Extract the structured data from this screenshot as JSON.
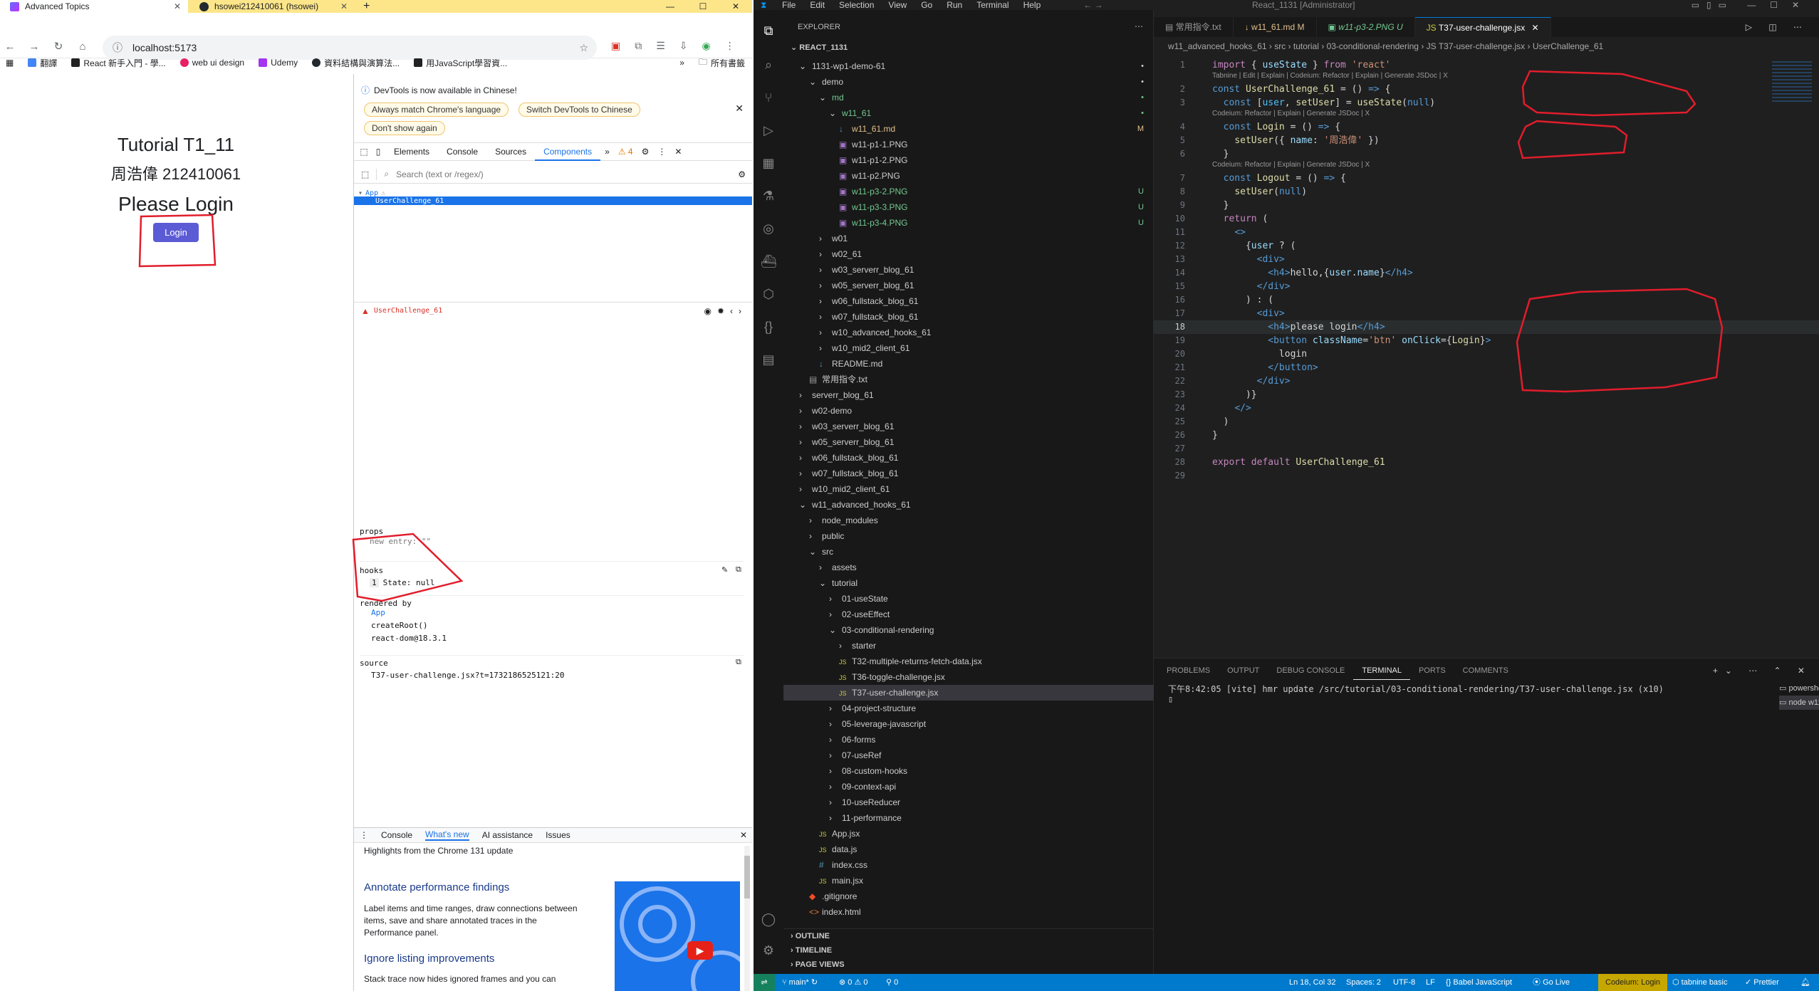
{
  "browser": {
    "tabs": [
      {
        "title": "Advanced Topics",
        "active": true
      },
      {
        "title": "hsowei212410061 (hsowei)",
        "active": false
      }
    ],
    "new_tab": "+",
    "url": "localhost:5173",
    "bookmarks": [
      "翻譯",
      "React 新手入門 - 學...",
      "web ui design",
      "Udemy",
      "資料結構與演算法...",
      "用JavaScript學習資..."
    ],
    "bookmarks_more": "»",
    "bookmarks_folder": "所有書籤"
  },
  "app": {
    "heading": "Tutorial T1_11",
    "subheading": "周浩偉 212410061",
    "please_login": "Please Login",
    "login_button": "Login"
  },
  "devtools": {
    "banner": "DevTools is now available in Chinese!",
    "pill_match": "Always match Chrome's language",
    "pill_switch": "Switch DevTools to Chinese",
    "pill_dont": "Don't show again",
    "tabs": [
      "Elements",
      "Console",
      "Sources",
      "Components"
    ],
    "more": "»",
    "warnings": "4",
    "search_placeholder": "Search (text or /regex/)",
    "tree_root": "App",
    "tree_child": "UserChallenge_61",
    "selected_name": "UserChallenge_61",
    "props_label": "props",
    "props_entry": "new entry: \"\"",
    "hooks_label": "hooks",
    "hook_index": "1",
    "hook_state": "State: null",
    "rendered_by_label": "rendered by",
    "rendered_by": [
      "App",
      "createRoot()",
      "react-dom@18.3.1"
    ],
    "source_label": "source",
    "source_file": "T37-user-challenge.jsx?t=1732186525121:20",
    "drawer_tabs": [
      "Console",
      "What's new",
      "AI assistance",
      "Issues"
    ],
    "highlights": "Highlights from the Chrome 131 update",
    "feature1_title": "Annotate performance findings",
    "feature1_body": "Label items and time ranges, draw connections between items, save and share annotated traces in the Performance panel.",
    "feature2_title": "Ignore listing improvements",
    "feature2_body": "Stack trace now hides ignored frames and you can"
  },
  "vscode": {
    "menu": [
      "File",
      "Edit",
      "Selection",
      "View",
      "Go",
      "Run",
      "Terminal",
      "Help"
    ],
    "search_box": "React_1131 [Administrator]",
    "explorer_title": "EXPLORER",
    "workspace": "REACT_1131",
    "tree": [
      {
        "label": "1131-wp1-demo-61",
        "depth": 1,
        "kind": "folder-open",
        "badge": "•"
      },
      {
        "label": "demo",
        "depth": 2,
        "kind": "folder-open",
        "badge": "•"
      },
      {
        "label": "md",
        "depth": 3,
        "kind": "folder-open",
        "badge": "•",
        "color": "#73c991"
      },
      {
        "label": "w11_61",
        "depth": 4,
        "kind": "folder-open",
        "badge": "•",
        "color": "#73c991"
      },
      {
        "label": "w11_61.md",
        "depth": 5,
        "kind": "md",
        "badge": "M",
        "color": "#e2c08d"
      },
      {
        "label": "w11-p1-1.PNG",
        "depth": 5,
        "kind": "img"
      },
      {
        "label": "w11-p1-2.PNG",
        "depth": 5,
        "kind": "img"
      },
      {
        "label": "w11-p2.PNG",
        "depth": 5,
        "kind": "img"
      },
      {
        "label": "w11-p3-2.PNG",
        "depth": 5,
        "kind": "img",
        "badge": "U",
        "color": "#73c991"
      },
      {
        "label": "w11-p3-3.PNG",
        "depth": 5,
        "kind": "img",
        "badge": "U",
        "color": "#73c991"
      },
      {
        "label": "w11-p3-4.PNG",
        "depth": 5,
        "kind": "img",
        "badge": "U",
        "color": "#73c991"
      },
      {
        "label": "w01",
        "depth": 3,
        "kind": "folder"
      },
      {
        "label": "w02_61",
        "depth": 3,
        "kind": "folder"
      },
      {
        "label": "w03_serverr_blog_61",
        "depth": 3,
        "kind": "folder"
      },
      {
        "label": "w05_serverr_blog_61",
        "depth": 3,
        "kind": "folder"
      },
      {
        "label": "w06_fullstack_blog_61",
        "depth": 3,
        "kind": "folder"
      },
      {
        "label": "w07_fullstack_blog_61",
        "depth": 3,
        "kind": "folder"
      },
      {
        "label": "w10_advanced_hooks_61",
        "depth": 3,
        "kind": "folder"
      },
      {
        "label": "w10_mid2_client_61",
        "depth": 3,
        "kind": "folder"
      },
      {
        "label": "README.md",
        "depth": 3,
        "kind": "md"
      },
      {
        "label": "常用指令.txt",
        "depth": 2,
        "kind": "txt"
      },
      {
        "label": "serverr_blog_61",
        "depth": 1,
        "kind": "folder"
      },
      {
        "label": "w02-demo",
        "depth": 1,
        "kind": "folder"
      },
      {
        "label": "w03_serverr_blog_61",
        "depth": 1,
        "kind": "folder"
      },
      {
        "label": "w05_serverr_blog_61",
        "depth": 1,
        "kind": "folder"
      },
      {
        "label": "w06_fullstack_blog_61",
        "depth": 1,
        "kind": "folder"
      },
      {
        "label": "w07_fullstack_blog_61",
        "depth": 1,
        "kind": "folder"
      },
      {
        "label": "w10_mid2_client_61",
        "depth": 1,
        "kind": "folder"
      },
      {
        "label": "w11_advanced_hooks_61",
        "depth": 1,
        "kind": "folder-open"
      },
      {
        "label": "node_modules",
        "depth": 2,
        "kind": "folder"
      },
      {
        "label": "public",
        "depth": 2,
        "kind": "folder"
      },
      {
        "label": "src",
        "depth": 2,
        "kind": "folder-open"
      },
      {
        "label": "assets",
        "depth": 3,
        "kind": "folder"
      },
      {
        "label": "tutorial",
        "depth": 3,
        "kind": "folder-open"
      },
      {
        "label": "01-useState",
        "depth": 4,
        "kind": "folder"
      },
      {
        "label": "02-useEffect",
        "depth": 4,
        "kind": "folder"
      },
      {
        "label": "03-conditional-rendering",
        "depth": 4,
        "kind": "folder-open"
      },
      {
        "label": "starter",
        "depth": 5,
        "kind": "folder"
      },
      {
        "label": "T32-multiple-returns-fetch-data.jsx",
        "depth": 5,
        "kind": "js"
      },
      {
        "label": "T36-toggle-challenge.jsx",
        "depth": 5,
        "kind": "js"
      },
      {
        "label": "T37-user-challenge.jsx",
        "depth": 5,
        "kind": "js",
        "selected": true
      },
      {
        "label": "04-project-structure",
        "depth": 4,
        "kind": "folder"
      },
      {
        "label": "05-leverage-javascript",
        "depth": 4,
        "kind": "folder"
      },
      {
        "label": "06-forms",
        "depth": 4,
        "kind": "folder"
      },
      {
        "label": "07-useRef",
        "depth": 4,
        "kind": "folder"
      },
      {
        "label": "08-custom-hooks",
        "depth": 4,
        "kind": "folder"
      },
      {
        "label": "09-context-api",
        "depth": 4,
        "kind": "folder"
      },
      {
        "label": "10-useReducer",
        "depth": 4,
        "kind": "folder"
      },
      {
        "label": "11-performance",
        "depth": 4,
        "kind": "folder"
      },
      {
        "label": "App.jsx",
        "depth": 3,
        "kind": "js"
      },
      {
        "label": "data.js",
        "depth": 3,
        "kind": "js"
      },
      {
        "label": "index.css",
        "depth": 3,
        "kind": "css"
      },
      {
        "label": "main.jsx",
        "depth": 3,
        "kind": "js"
      },
      {
        "label": ".gitignore",
        "depth": 2,
        "kind": "git"
      },
      {
        "label": "index.html",
        "depth": 2,
        "kind": "html"
      }
    ],
    "outline": "OUTLINE",
    "timeline": "TIMELINE",
    "page_views": "PAGE VIEWS",
    "editor_tabs": [
      "常用指令.txt",
      "w11_61.md M",
      "w11-p3-2.PNG U",
      "T37-user-challenge.jsx"
    ],
    "breadcrumb": "w11_advanced_hooks_61 › src › tutorial › 03-conditional-rendering › JS T37-user-challenge.jsx › UserChallenge_61",
    "lens_tabnine": "Tabnine | Edit | Explain | Codeium: Refactor | Explain | Generate JSDoc | X",
    "lens_codeium": "Codeium: Refactor | Explain | Generate JSDoc | X",
    "panel_tabs": [
      "PROBLEMS",
      "OUTPUT",
      "DEBUG CONSOLE",
      "TERMINAL",
      "PORTS",
      "COMMENTS"
    ],
    "terminal_line": "下午8:42:05 [vite] hmr update /src/tutorial/03-conditional-rendering/T37-user-challenge.jsx (x10)",
    "terminals": [
      "powershell",
      "node w11_a..."
    ],
    "status": {
      "branch": "main*",
      "errors": "⊗ 0 ⚠ 0",
      "ports": "⚲ 0",
      "position": "Ln 18, Col 32",
      "spaces": "Spaces: 2",
      "encoding": "UTF-8",
      "eol": "LF",
      "language": "Babel JavaScript",
      "golive": "Go Live",
      "codeium": "Codeium: Login",
      "tabnine": "tabnine basic",
      "prettier": "Prettier"
    }
  },
  "code_lines": [
    {
      "n": "1",
      "segs": [
        [
          "kw2",
          "import"
        ],
        [
          "pun",
          " { "
        ],
        [
          "var",
          "useState"
        ],
        [
          "pun",
          " } "
        ],
        [
          "kw2",
          "from"
        ],
        [
          "str",
          " 'react'"
        ]
      ]
    },
    {
      "n": "2",
      "segs": [
        [
          "kw",
          "const"
        ],
        [
          "pun",
          " "
        ],
        [
          "fn",
          "UserChallenge_61"
        ],
        [
          "pun",
          " = () "
        ],
        [
          "kw",
          "=>"
        ],
        [
          "pun",
          " {"
        ]
      ]
    },
    {
      "n": "3",
      "segs": [
        [
          "pun",
          "  "
        ],
        [
          "kw",
          "const"
        ],
        [
          "pun",
          " ["
        ],
        [
          "cst",
          "user"
        ],
        [
          "pun",
          ", "
        ],
        [
          "fn",
          "setUser"
        ],
        [
          "pun",
          "] = "
        ],
        [
          "fn",
          "useState"
        ],
        [
          "pun",
          "("
        ],
        [
          "kw",
          "null"
        ],
        [
          "pun",
          ")"
        ]
      ]
    },
    {
      "n": "4",
      "segs": [
        [
          "pun",
          "  "
        ],
        [
          "kw",
          "const"
        ],
        [
          "pun",
          " "
        ],
        [
          "fn",
          "Login"
        ],
        [
          "pun",
          " = () "
        ],
        [
          "kw",
          "=>"
        ],
        [
          "pun",
          " {"
        ]
      ]
    },
    {
      "n": "5",
      "segs": [
        [
          "pun",
          "    "
        ],
        [
          "fn",
          "setUser"
        ],
        [
          "pun",
          "({ "
        ],
        [
          "var",
          "name"
        ],
        [
          "pun",
          ": "
        ],
        [
          "str",
          "'周浩偉'"
        ],
        [
          "pun",
          " })"
        ]
      ]
    },
    {
      "n": "6",
      "segs": [
        [
          "pun",
          "  }"
        ]
      ]
    },
    {
      "n": "7",
      "segs": [
        [
          "pun",
          "  "
        ],
        [
          "kw",
          "const"
        ],
        [
          "pun",
          " "
        ],
        [
          "fn",
          "Logout"
        ],
        [
          "pun",
          " = () "
        ],
        [
          "kw",
          "=>"
        ],
        [
          "pun",
          " {"
        ]
      ]
    },
    {
      "n": "8",
      "segs": [
        [
          "pun",
          "    "
        ],
        [
          "fn",
          "setUser"
        ],
        [
          "pun",
          "("
        ],
        [
          "kw",
          "null"
        ],
        [
          "pun",
          ")"
        ]
      ]
    },
    {
      "n": "9",
      "segs": [
        [
          "pun",
          "  }"
        ]
      ]
    },
    {
      "n": "10",
      "segs": [
        [
          "pun",
          "  "
        ],
        [
          "kw2",
          "return"
        ],
        [
          "pun",
          " ("
        ]
      ]
    },
    {
      "n": "11",
      "segs": [
        [
          "pun",
          "    "
        ],
        [
          "tag",
          "<>"
        ]
      ]
    },
    {
      "n": "12",
      "segs": [
        [
          "pun",
          "      {"
        ],
        [
          "var",
          "user"
        ],
        [
          "pun",
          " ? ("
        ]
      ]
    },
    {
      "n": "13",
      "segs": [
        [
          "pun",
          "        "
        ],
        [
          "tag",
          "<div>"
        ]
      ]
    },
    {
      "n": "14",
      "segs": [
        [
          "pun",
          "          "
        ],
        [
          "tag",
          "<h4>"
        ],
        [
          "txt",
          "hello,{"
        ],
        [
          "var",
          "user"
        ],
        [
          "pun",
          "."
        ],
        [
          "var",
          "name"
        ],
        [
          "txt",
          "}"
        ],
        [
          "tag",
          "</h4>"
        ]
      ]
    },
    {
      "n": "15",
      "segs": [
        [
          "pun",
          "        "
        ],
        [
          "tag",
          "</div>"
        ]
      ]
    },
    {
      "n": "16",
      "segs": [
        [
          "pun",
          "      ) : ("
        ]
      ]
    },
    {
      "n": "17",
      "segs": [
        [
          "pun",
          "        "
        ],
        [
          "tag",
          "<div>"
        ]
      ]
    },
    {
      "n": "18",
      "segs": [
        [
          "pun",
          "          "
        ],
        [
          "tag",
          "<h4>"
        ],
        [
          "txt",
          "please login"
        ],
        [
          "tag",
          "</h4>"
        ]
      ]
    },
    {
      "n": "19",
      "segs": [
        [
          "pun",
          "          "
        ],
        [
          "tag",
          "<button"
        ],
        [
          "pun",
          " "
        ],
        [
          "attr",
          "className"
        ],
        [
          "pun",
          "="
        ],
        [
          "str",
          "'btn'"
        ],
        [
          "pun",
          " "
        ],
        [
          "attr",
          "onClick"
        ],
        [
          "pun",
          "={"
        ],
        [
          "fn",
          "Login"
        ],
        [
          "pun",
          "}"
        ],
        [
          "tag",
          ">"
        ]
      ]
    },
    {
      "n": "20",
      "segs": [
        [
          "txt",
          "            login"
        ]
      ]
    },
    {
      "n": "21",
      "segs": [
        [
          "pun",
          "          "
        ],
        [
          "tag",
          "</button>"
        ]
      ]
    },
    {
      "n": "22",
      "segs": [
        [
          "pun",
          "        "
        ],
        [
          "tag",
          "</div>"
        ]
      ]
    },
    {
      "n": "23",
      "segs": [
        [
          "pun",
          "      )}"
        ]
      ]
    },
    {
      "n": "24",
      "segs": [
        [
          "pun",
          "    "
        ],
        [
          "tag",
          "</>"
        ]
      ]
    },
    {
      "n": "25",
      "segs": [
        [
          "pun",
          "  )"
        ]
      ]
    },
    {
      "n": "26",
      "segs": [
        [
          "pun",
          "}"
        ]
      ]
    },
    {
      "n": "27",
      "segs": []
    },
    {
      "n": "28",
      "segs": [
        [
          "kw2",
          "export"
        ],
        [
          "pun",
          " "
        ],
        [
          "kw2",
          "default"
        ],
        [
          "pun",
          " "
        ],
        [
          "fn",
          "UserChallenge_61"
        ]
      ]
    },
    {
      "n": "29",
      "segs": []
    }
  ],
  "colors": {
    "annotation": "#e11d2b",
    "accent": "#007acc",
    "devtools_select": "#1a73e8"
  }
}
